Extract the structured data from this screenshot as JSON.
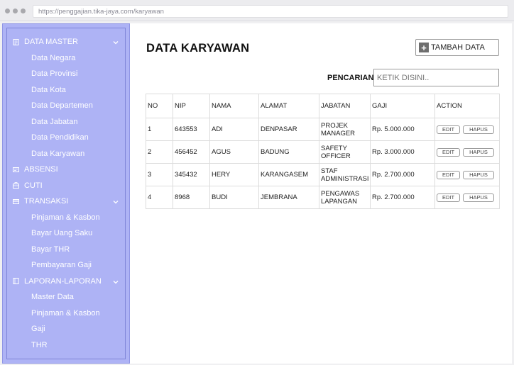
{
  "browser": {
    "url": "https://penggajian.tika-jaya.com/karyawan"
  },
  "sidebar": {
    "items": [
      {
        "label": "DATA MASTER",
        "type": "section",
        "icon": "document-icon",
        "chevron": true
      },
      {
        "label": "Data Negara",
        "type": "sub"
      },
      {
        "label": "Data Provinsi",
        "type": "sub"
      },
      {
        "label": "Data Kota",
        "type": "sub"
      },
      {
        "label": "Data Departemen",
        "type": "sub"
      },
      {
        "label": "Data Jabatan",
        "type": "sub"
      },
      {
        "label": "Data Pendidikan",
        "type": "sub"
      },
      {
        "label": "Data Karyawan",
        "type": "sub"
      },
      {
        "label": "ABSENSI",
        "type": "section",
        "icon": "card-icon",
        "chevron": false
      },
      {
        "label": "CUTI",
        "type": "section",
        "icon": "briefcase-icon",
        "chevron": false
      },
      {
        "label": "TRANSAKSI",
        "type": "section",
        "icon": "credit-card-icon",
        "chevron": true
      },
      {
        "label": "Pinjaman & Kasbon",
        "type": "sub"
      },
      {
        "label": "Bayar Uang Saku",
        "type": "sub"
      },
      {
        "label": "Bayar THR",
        "type": "sub"
      },
      {
        "label": "Pembayaran Gaji",
        "type": "sub"
      },
      {
        "label": "LAPORAN-LAPORAN",
        "type": "section",
        "icon": "book-icon",
        "chevron": true
      },
      {
        "label": "Master Data",
        "type": "sub"
      },
      {
        "label": "Pinjaman & Kasbon",
        "type": "sub"
      },
      {
        "label": "Gaji",
        "type": "sub"
      },
      {
        "label": "THR",
        "type": "sub"
      }
    ]
  },
  "main": {
    "title": "DATA KARYAWAN",
    "add_button": "TAMBAH DATA",
    "search": {
      "label": "PENCARIAN",
      "placeholder": "KETIK DISINI.."
    },
    "table": {
      "columns": [
        "NO",
        "NIP",
        "NAMA",
        "ALAMAT",
        "JABATAN",
        "GAJI",
        "ACTION"
      ],
      "rows": [
        {
          "no": "1",
          "nip": "643553",
          "nama": "ADI",
          "alamat": "DENPASAR",
          "jabatan_1": "PROJEK",
          "jabatan_2": "MANAGER",
          "gaji": "Rp. 5.000.000"
        },
        {
          "no": "2",
          "nip": "456452",
          "nama": "AGUS",
          "alamat": "BADUNG",
          "jabatan_1": "SAFETY",
          "jabatan_2": "OFFICER",
          "gaji": "Rp. 3.000.000"
        },
        {
          "no": "3",
          "nip": "345432",
          "nama": "HERY",
          "alamat": "KARANGASEM",
          "jabatan_1": "STAF",
          "jabatan_2": "ADMINISTRASI",
          "gaji": "Rp. 2.700.000"
        },
        {
          "no": "4",
          "nip": "8968",
          "nama": "BUDI",
          "alamat": "JEMBRANA",
          "jabatan_1": "PENGAWAS",
          "jabatan_2": "LAPANGAN",
          "gaji": "Rp. 2.700.000"
        }
      ],
      "edit_label": "EDIT",
      "delete_label": "HAPUS"
    }
  },
  "colors": {
    "sidebar_bg": "#aeb3f5",
    "sidebar_text": "#ffffff"
  }
}
